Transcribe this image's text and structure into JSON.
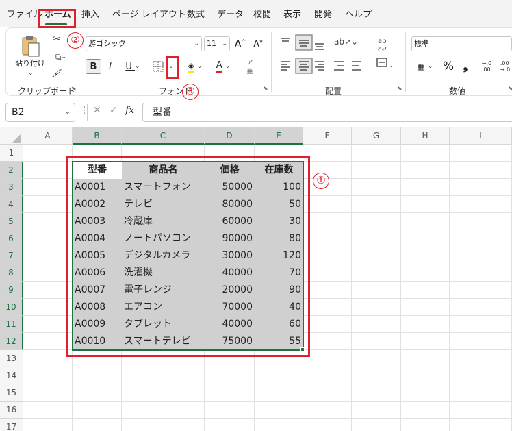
{
  "menu": {
    "tabs": [
      "ファイル",
      "ホーム",
      "挿入",
      "ページ レイアウト",
      "数式",
      "データ",
      "校閲",
      "表示",
      "開発",
      "ヘルプ"
    ],
    "active": "ホーム"
  },
  "ribbon": {
    "clipboard": {
      "paste_label": "貼り付け",
      "group_label": "クリップボード"
    },
    "font": {
      "font_name": "游ゴシック",
      "font_size": "11",
      "bold": "B",
      "italic": "I",
      "underline": "U",
      "font_color_glyph": "A",
      "group_label": "フォント"
    },
    "alignment": {
      "group_label": "配置"
    },
    "number": {
      "format": "標準",
      "percent": "%",
      "comma": "❟",
      "group_label": "数値"
    }
  },
  "formula_bar": {
    "name_box": "B2",
    "fx": "fx",
    "content": "型番"
  },
  "grid": {
    "columns": [
      "A",
      "B",
      "C",
      "D",
      "E",
      "F",
      "G",
      "H",
      "I"
    ],
    "rows": [
      "1",
      "2",
      "3",
      "4",
      "5",
      "6",
      "7",
      "8",
      "9",
      "10",
      "11",
      "12",
      "13",
      "14",
      "15",
      "16",
      "17"
    ],
    "headers": [
      "型番",
      "商品名",
      "価格",
      "在庫数"
    ],
    "data": [
      [
        "A0001",
        "スマートフォン",
        "50000",
        "100"
      ],
      [
        "A0002",
        "テレビ",
        "80000",
        "50"
      ],
      [
        "A0003",
        "冷蔵庫",
        "60000",
        "30"
      ],
      [
        "A0004",
        "ノートパソコン",
        "90000",
        "80"
      ],
      [
        "A0005",
        "デジタルカメラ",
        "30000",
        "120"
      ],
      [
        "A0006",
        "洗濯機",
        "40000",
        "70"
      ],
      [
        "A0007",
        "電子レンジ",
        "20000",
        "90"
      ],
      [
        "A0008",
        "エアコン",
        "70000",
        "40"
      ],
      [
        "A0009",
        "タブレット",
        "40000",
        "60"
      ],
      [
        "A0010",
        "スマートテレビ",
        "75000",
        "55"
      ]
    ]
  },
  "annotations": [
    "①",
    "②",
    "③"
  ],
  "colors": {
    "accent": "#1e7145",
    "annotation_red": "#e0202b",
    "selection_gray": "#d0d0d0"
  }
}
